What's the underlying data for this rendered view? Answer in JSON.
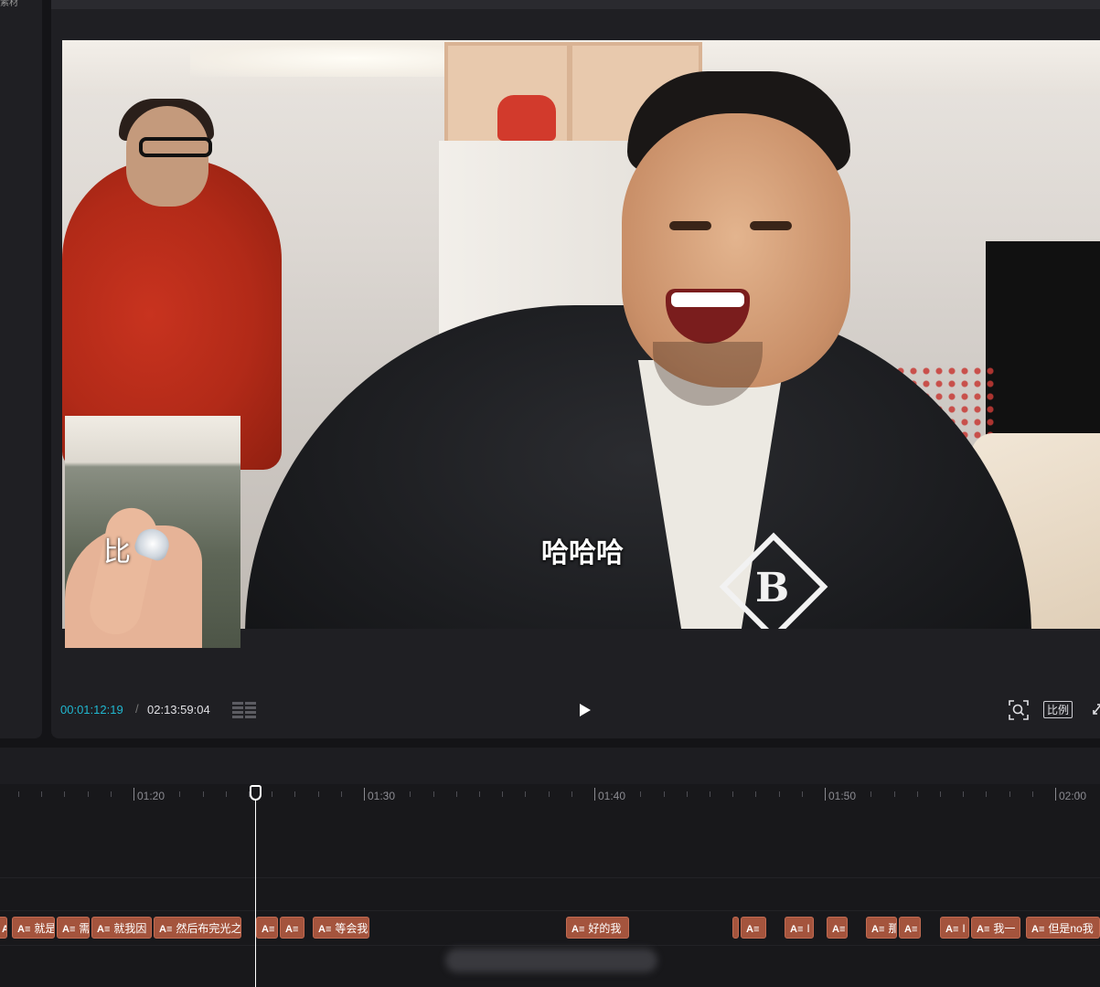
{
  "left_panel": {
    "title": "素材"
  },
  "player": {
    "subtitle": "哈哈哈",
    "pip_text": "比",
    "current_time": "00:01:12:19",
    "separator": "/",
    "total_time": "02:13:59:04",
    "ratio_label": "比例",
    "icons": [
      "list-icon",
      "play-icon",
      "zoom-icon",
      "fullscreen-icon"
    ]
  },
  "timeline": {
    "ruler_labels": [
      "01:20",
      "01:30",
      "01:40",
      "01:50",
      "02:00"
    ],
    "clip_icon": "A≡",
    "clips": [
      {
        "text": ""
      },
      {
        "text": "就是"
      },
      {
        "text": "需"
      },
      {
        "text": "就我因"
      },
      {
        "text": "然后布完光之"
      },
      {
        "text": ""
      },
      {
        "text": ""
      },
      {
        "text": "等会我"
      },
      {
        "text": "好的我"
      },
      {
        "text": ""
      },
      {
        "text": ""
      },
      {
        "text": "I"
      },
      {
        "text": ""
      },
      {
        "text": "那"
      },
      {
        "text": ""
      },
      {
        "text": "I"
      },
      {
        "text": "我一"
      },
      {
        "text": "但是no我"
      }
    ]
  },
  "colors": {
    "accent_time": "#20b7cf",
    "clip": "#a4543d",
    "background": "#141417"
  }
}
